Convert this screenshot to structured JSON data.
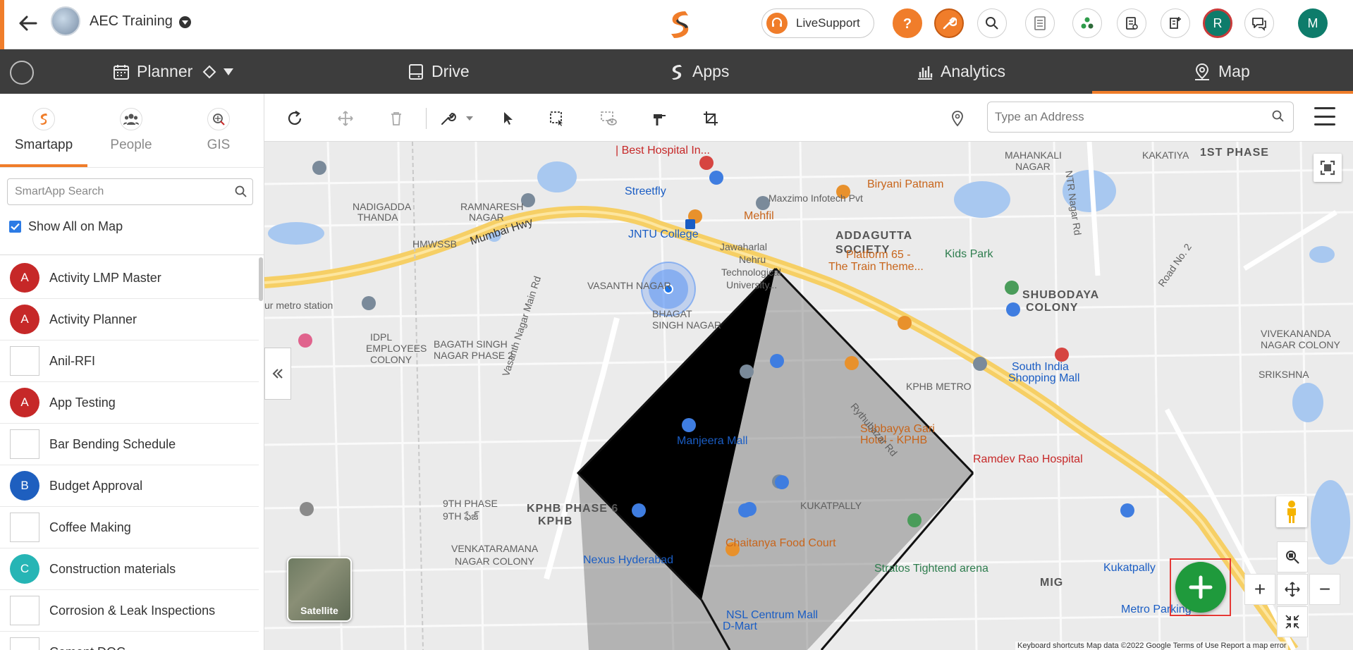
{
  "header": {
    "project_title": "AEC Training",
    "live_support_label": "LiveSupport",
    "user_avatar_1": "R",
    "user_avatar_2": "M"
  },
  "nav": {
    "items": [
      {
        "label": "Planner",
        "icon": "calendar-icon"
      },
      {
        "label": "Drive",
        "icon": "drive-icon"
      },
      {
        "label": "Apps",
        "icon": "apps-icon"
      },
      {
        "label": "Analytics",
        "icon": "analytics-icon"
      },
      {
        "label": "Map",
        "icon": "map-pin-icon"
      }
    ],
    "active": "Map"
  },
  "sidebar": {
    "tabs": [
      {
        "label": "Smartapp",
        "icon": "smartapp-icon"
      },
      {
        "label": "People",
        "icon": "people-icon"
      },
      {
        "label": "GIS",
        "icon": "gis-icon"
      }
    ],
    "active_tab": "Smartapp",
    "search_placeholder": "SmartApp Search",
    "show_all_label": "Show All on Map",
    "show_all_checked": true,
    "items": [
      {
        "label": "Activity LMP Master",
        "initial": "A",
        "color": "#c62828"
      },
      {
        "label": "Activity Planner",
        "initial": "A",
        "color": "#c62828"
      },
      {
        "label": "Anil-RFI",
        "initial": "",
        "color": "image"
      },
      {
        "label": "App Testing",
        "initial": "A",
        "color": "#c62828"
      },
      {
        "label": "Bar Bending Schedule",
        "initial": "",
        "color": "image"
      },
      {
        "label": "Budget Approval",
        "initial": "B",
        "color": "#1e5fbf"
      },
      {
        "label": "Coffee Making",
        "initial": "",
        "color": "image"
      },
      {
        "label": "Construction materials",
        "initial": "C",
        "color": "#26b5b5"
      },
      {
        "label": "Corrosion & Leak Inspections",
        "initial": "",
        "color": "image"
      },
      {
        "label": "Cement DOC",
        "initial": "",
        "color": "image"
      }
    ]
  },
  "map_toolbar": {
    "address_placeholder": "Type an Address"
  },
  "map": {
    "satellite_label": "Satellite",
    "attribution": "Keyboard shortcuts   Map data ©2022 Google   Terms of Use   Report a map error",
    "labels": [
      {
        "t": "| Best Hospital In...",
        "cls": "red"
      },
      {
        "t": "Biryani Patnam",
        "cls": "orange"
      },
      {
        "t": "Maxzimo Infotech Pvt",
        "cls": ""
      },
      {
        "t": "Streetfly",
        "cls": "blue"
      },
      {
        "t": "Mehfil",
        "cls": "orange"
      },
      {
        "t": "JNTU College",
        "cls": "blue"
      },
      {
        "t": "ADDAGUTTA",
        "cls": "big"
      },
      {
        "t": "SOCIETY",
        "cls": "big"
      },
      {
        "t": "Mumbai Hwy",
        "cls": "dark"
      },
      {
        "t": "HMWSSB",
        "cls": ""
      },
      {
        "t": "Kids Park",
        "cls": "green"
      },
      {
        "t": "Platform 65 -",
        "cls": "orange"
      },
      {
        "t": "The Train Theme...",
        "cls": "orange"
      },
      {
        "t": "Jawaharlal",
        "cls": ""
      },
      {
        "t": "Nehru",
        "cls": ""
      },
      {
        "t": "Technological",
        "cls": ""
      },
      {
        "t": "University...",
        "cls": ""
      },
      {
        "t": "VASANTH NAGAR",
        "cls": ""
      },
      {
        "t": "BHAGAT",
        "cls": ""
      },
      {
        "t": "SINGH NAGAR",
        "cls": ""
      },
      {
        "t": "IDPL",
        "cls": ""
      },
      {
        "t": "EMPLOYEES",
        "cls": ""
      },
      {
        "t": "COLONY",
        "cls": ""
      },
      {
        "t": "BAGATH SINGH",
        "cls": ""
      },
      {
        "t": "NAGAR PHASE 2",
        "cls": ""
      },
      {
        "t": "ur metro station",
        "cls": ""
      },
      {
        "t": "KPHB METRO",
        "cls": ""
      },
      {
        "t": "South India",
        "cls": "blue"
      },
      {
        "t": "Shopping Mall",
        "cls": "blue"
      },
      {
        "t": "Manjeera Mall",
        "cls": "blue"
      },
      {
        "t": "Subbayya Gari",
        "cls": "orange"
      },
      {
        "t": "Hotel - KPHB",
        "cls": "orange"
      },
      {
        "t": "Ramdev Rao Hospital",
        "cls": "red"
      },
      {
        "t": "KPHB PHASE 6",
        "cls": "big"
      },
      {
        "t": "KPHB",
        "cls": "big"
      },
      {
        "t": "9TH PHASE",
        "cls": ""
      },
      {
        "t": "9TH ఫేజ్",
        "cls": ""
      },
      {
        "t": "KUKATPALLY",
        "cls": ""
      },
      {
        "t": "VENKATARAMANA",
        "cls": ""
      },
      {
        "t": "NAGAR COLONY",
        "cls": ""
      },
      {
        "t": "Chaitanya Food Court",
        "cls": "orange"
      },
      {
        "t": "Nexus Hyderabad",
        "cls": "blue"
      },
      {
        "t": "Stratos Tightend arena",
        "cls": "green"
      },
      {
        "t": "NSL Centrum Mall",
        "cls": "blue"
      },
      {
        "t": "D-Mart",
        "cls": "blue"
      },
      {
        "t": "MIG",
        "cls": "big"
      },
      {
        "t": "Kukatpally",
        "cls": "blue"
      },
      {
        "t": "Metro Parking",
        "cls": "blue"
      },
      {
        "t": "MAHANKALI",
        "cls": ""
      },
      {
        "t": "NAGAR",
        "cls": ""
      },
      {
        "t": "NADIGADDA",
        "cls": ""
      },
      {
        "t": "THANDA",
        "cls": ""
      },
      {
        "t": "RAMNARESH",
        "cls": ""
      },
      {
        "t": "NAGAR",
        "cls": ""
      },
      {
        "t": "SHUBODAYA",
        "cls": "big"
      },
      {
        "t": "COLONY",
        "cls": "big"
      },
      {
        "t": "1ST PHASE",
        "cls": "big"
      },
      {
        "t": "VIVEKANANDA",
        "cls": ""
      },
      {
        "t": "NAGAR COLONY",
        "cls": ""
      },
      {
        "t": "SRIKSHNA",
        "cls": ""
      },
      {
        "t": "KAKATIYA",
        "cls": ""
      },
      {
        "t": "Vasanth Nagar Main Rd",
        "cls": ""
      },
      {
        "t": "Rythubazar Rd",
        "cls": ""
      },
      {
        "t": "Road No. 2",
        "cls": ""
      },
      {
        "t": "NTR Nagar Rd",
        "cls": ""
      }
    ]
  }
}
